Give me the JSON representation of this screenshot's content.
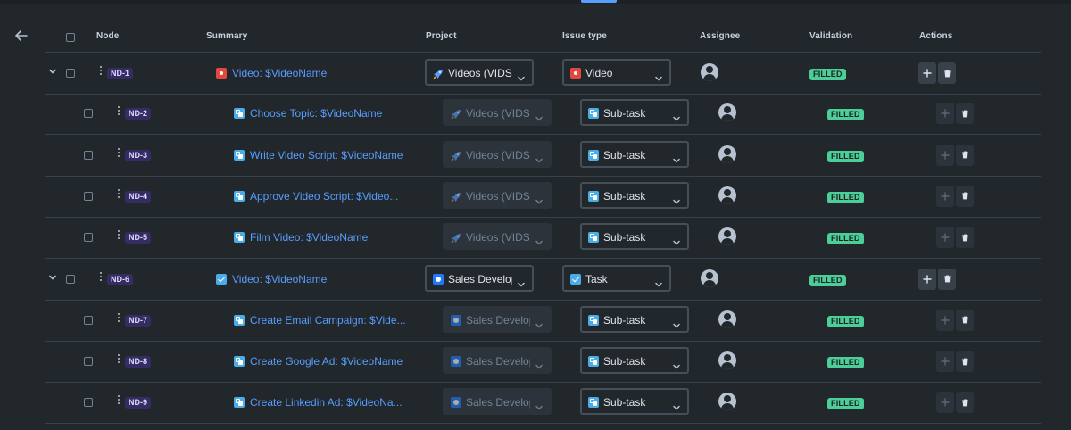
{
  "headers": {
    "node": "Node",
    "summary": "Summary",
    "project": "Project",
    "issue_type": "Issue type",
    "assignee": "Assignee",
    "validation": "Validation",
    "actions": "Actions"
  },
  "colors": {
    "background": "#22272b",
    "link": "#579dff",
    "key_badge_bg": "#352c63",
    "filled_badge_bg": "#4bce97",
    "video_icon": "#e2483d",
    "subtask_icon": "#4bade8"
  },
  "rows": [
    {
      "key": "ND-1",
      "summary": "Video: $VideoName",
      "type_icon": "video-icon",
      "project": "Videos (VIDS)",
      "project_icon": "rocket-icon",
      "issue_type": "Video",
      "validation": "FILLED",
      "parent": true
    },
    {
      "key": "ND-2",
      "summary": "Choose Topic: $VideoName",
      "type_icon": "subtask-icon",
      "project": "Videos (VIDS)",
      "project_icon": "rocket-icon",
      "issue_type": "Sub-task",
      "validation": "FILLED",
      "parent": false
    },
    {
      "key": "ND-3",
      "summary": "Write Video Script: $VideoName",
      "type_icon": "subtask-icon",
      "project": "Videos (VIDS)",
      "project_icon": "rocket-icon",
      "issue_type": "Sub-task",
      "validation": "FILLED",
      "parent": false
    },
    {
      "key": "ND-4",
      "summary": "Approve Video Script: $Video...",
      "type_icon": "subtask-icon",
      "project": "Videos (VIDS)",
      "project_icon": "rocket-icon",
      "issue_type": "Sub-task",
      "validation": "FILLED",
      "parent": false
    },
    {
      "key": "ND-5",
      "summary": "Film Video: $VideoName",
      "type_icon": "subtask-icon",
      "project": "Videos (VIDS)",
      "project_icon": "rocket-icon",
      "issue_type": "Sub-task",
      "validation": "FILLED",
      "parent": false
    },
    {
      "key": "ND-6",
      "summary": "Video: $VideoName",
      "type_icon": "task-icon",
      "project": "Sales Development",
      "project_icon": "sales-project-icon",
      "issue_type": "Task",
      "validation": "FILLED",
      "parent": true
    },
    {
      "key": "ND-7",
      "summary": "Create Email Campaign: $Vide...",
      "type_icon": "subtask-icon",
      "project": "Sales Development",
      "project_icon": "sales-project-icon",
      "issue_type": "Sub-task",
      "validation": "FILLED",
      "parent": false
    },
    {
      "key": "ND-8",
      "summary": "Create Google Ad: $VideoName",
      "type_icon": "subtask-icon",
      "project": "Sales Development",
      "project_icon": "sales-project-icon",
      "issue_type": "Sub-task",
      "validation": "FILLED",
      "parent": false
    },
    {
      "key": "ND-9",
      "summary": "Create Linkedin Ad: $VideoNa...",
      "type_icon": "subtask-icon",
      "project": "Sales Development",
      "project_icon": "sales-project-icon",
      "issue_type": "Sub-task",
      "validation": "FILLED",
      "parent": false
    }
  ]
}
